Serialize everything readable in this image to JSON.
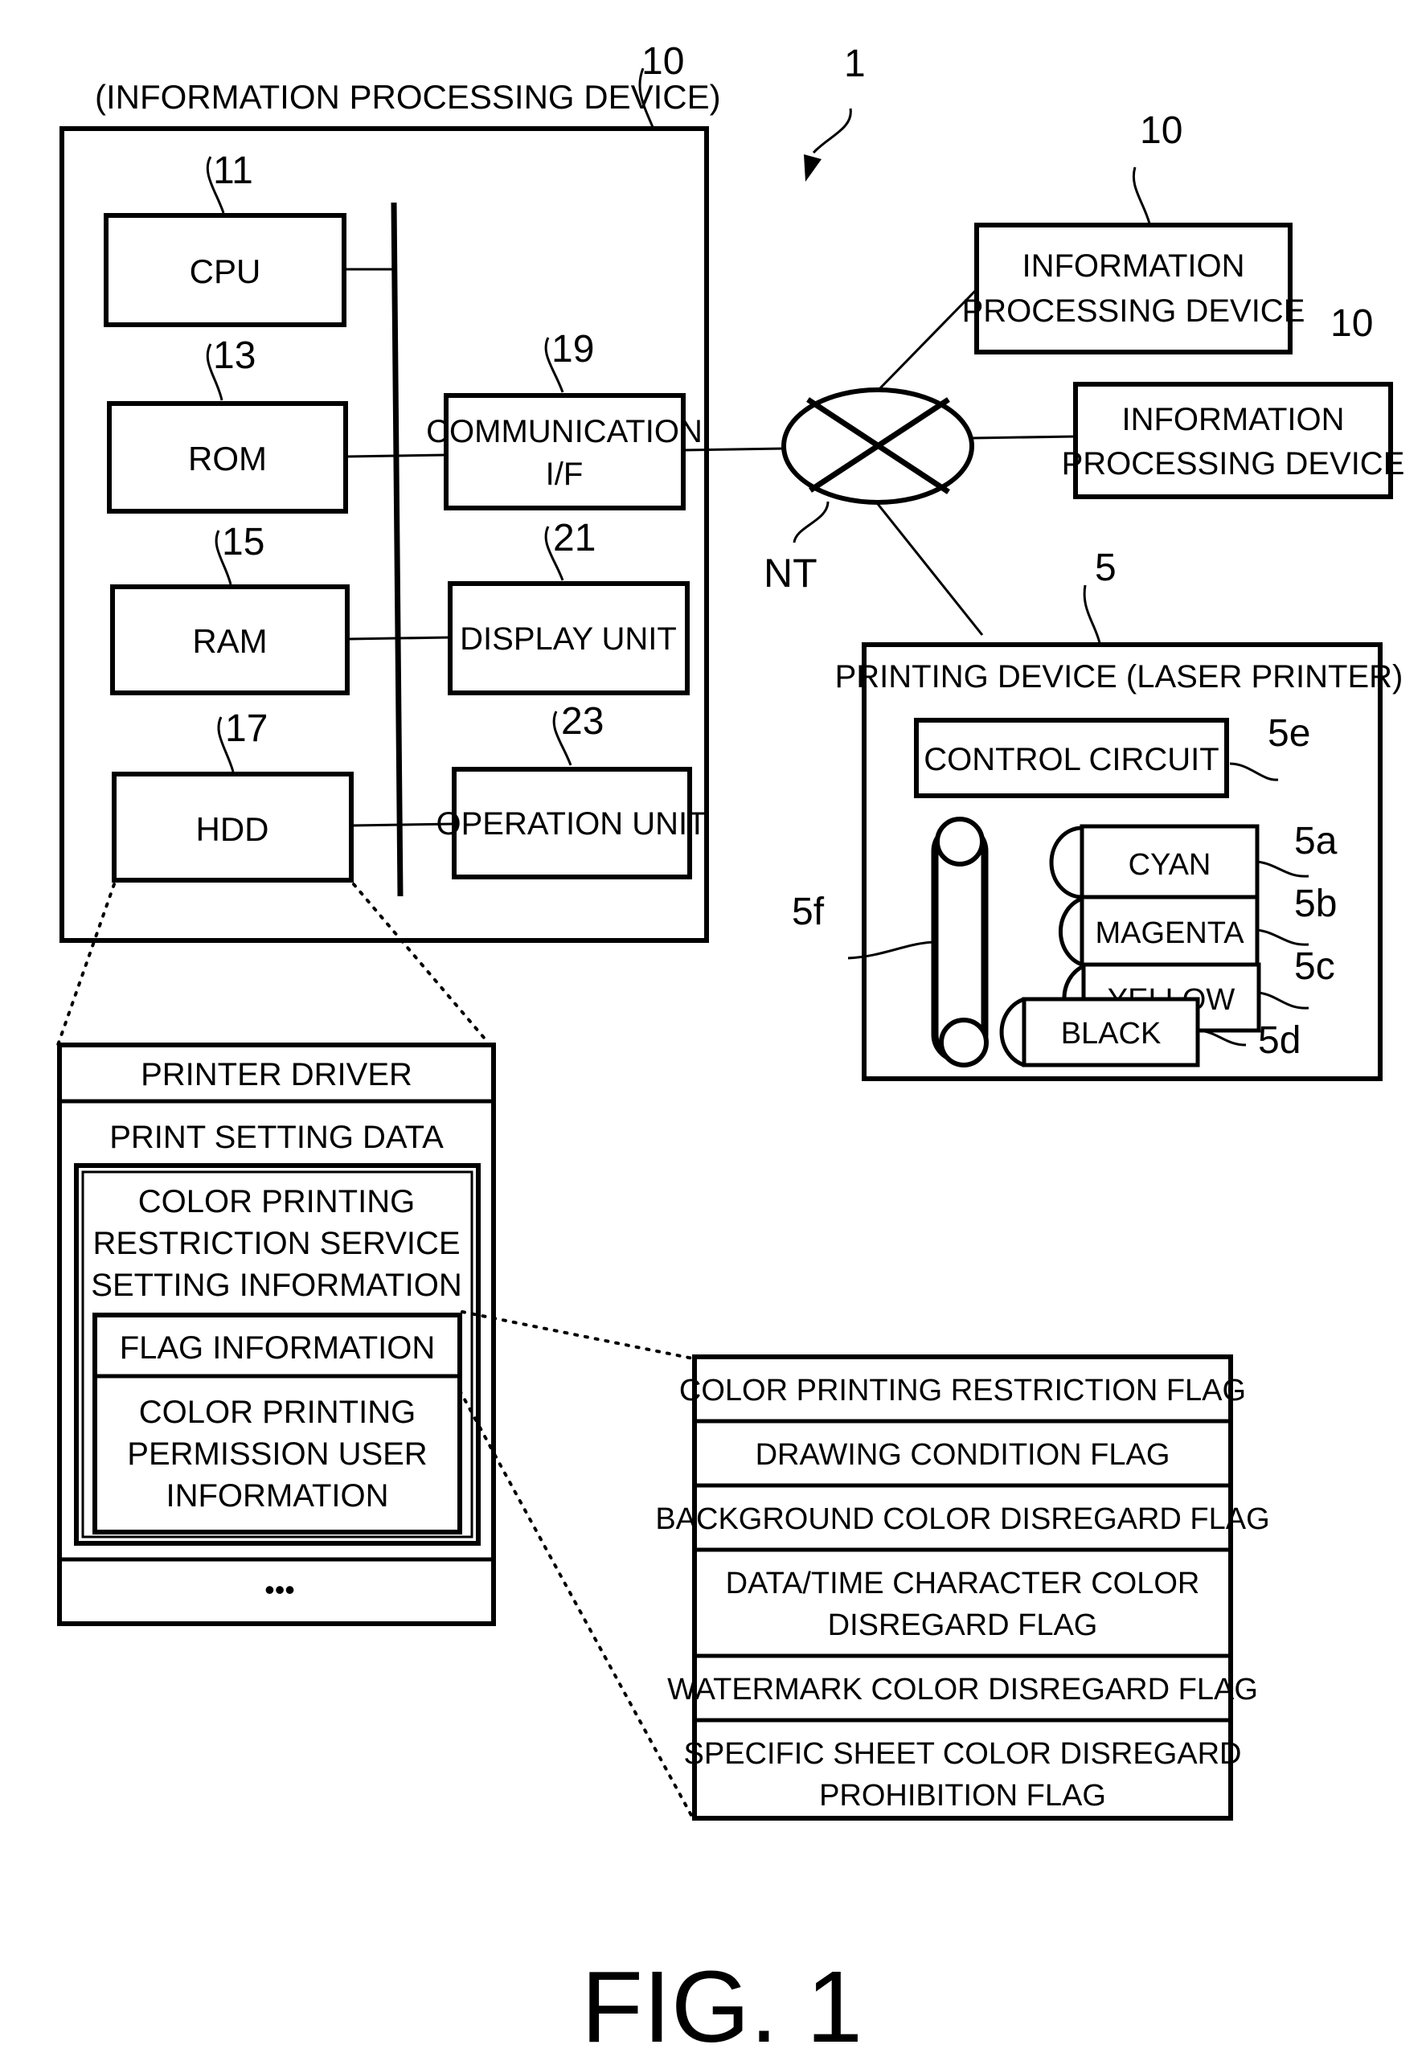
{
  "figure": {
    "caption": "FIG. 1",
    "system_ref": "1"
  },
  "main_device": {
    "title": "(INFORMATION PROCESSING DEVICE)",
    "ref": "10",
    "components": [
      {
        "label": "CPU",
        "ref": "11"
      },
      {
        "label": "ROM",
        "ref": "13"
      },
      {
        "label": "RAM",
        "ref": "15"
      },
      {
        "label": "HDD",
        "ref": "17"
      },
      {
        "label_lines": [
          "COMMUNICATION",
          "I/F"
        ],
        "ref": "19"
      },
      {
        "label": "DISPLAY UNIT",
        "ref": "21"
      },
      {
        "label": "OPERATION UNIT",
        "ref": "23"
      }
    ]
  },
  "network": {
    "label": "NT"
  },
  "remote_devices": [
    {
      "label_lines": [
        "INFORMATION",
        "PROCESSING DEVICE"
      ],
      "ref": "10"
    },
    {
      "label_lines": [
        "INFORMATION",
        "PROCESSING DEVICE"
      ],
      "ref": "10"
    }
  ],
  "printer": {
    "title": "PRINTING DEVICE (LASER PRINTER)",
    "ref": "5",
    "control_circuit": {
      "label": "CONTROL CIRCUIT",
      "ref": "5e"
    },
    "belt_ref": "5f",
    "cartridges": [
      {
        "label": "CYAN",
        "ref": "5a"
      },
      {
        "label": "MAGENTA",
        "ref": "5b"
      },
      {
        "label": "YELLOW",
        "ref": "5c"
      },
      {
        "label": "BLACK",
        "ref": "5d"
      }
    ]
  },
  "hdd_contents": {
    "printer_driver": "PRINTER DRIVER",
    "print_setting_data": "PRINT SETTING DATA",
    "service_setting_lines": [
      "COLOR PRINTING",
      "RESTRICTION SERVICE",
      "SETTING INFORMATION"
    ],
    "flag_information": "FLAG INFORMATION",
    "permission_user_lines": [
      "COLOR PRINTING",
      "PERMISSION USER",
      "INFORMATION"
    ],
    "ellipsis": "•••"
  },
  "flags": [
    [
      "COLOR PRINTING RESTRICTION FLAG"
    ],
    [
      "DRAWING CONDITION FLAG"
    ],
    [
      "BACKGROUND COLOR DISREGARD FLAG"
    ],
    [
      "DATA/TIME CHARACTER COLOR",
      "DISREGARD FLAG"
    ],
    [
      "WATERMARK COLOR DISREGARD FLAG"
    ],
    [
      "SPECIFIC SHEET COLOR DISREGARD",
      "PROHIBITION FLAG"
    ]
  ]
}
